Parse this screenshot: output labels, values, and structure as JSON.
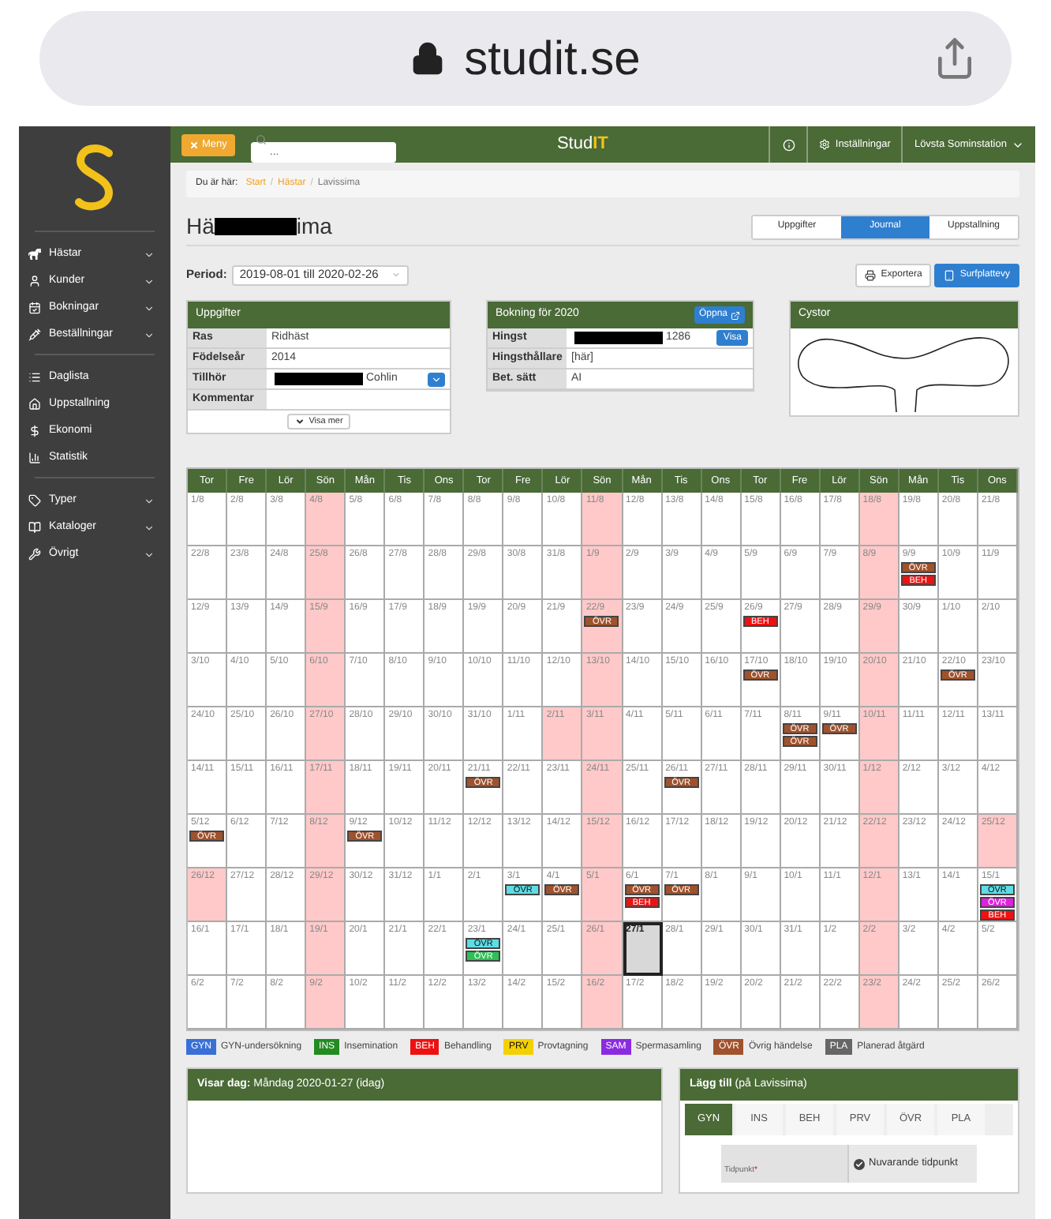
{
  "browser": {
    "url": "studit.se"
  },
  "sidebar": {
    "groups": [
      {
        "items": [
          {
            "label": "Hästar",
            "expandable": true
          },
          {
            "label": "Kunder",
            "expandable": true
          },
          {
            "label": "Bokningar",
            "expandable": true
          },
          {
            "label": "Beställningar",
            "expandable": true
          }
        ]
      },
      {
        "items": [
          {
            "label": "Daglista",
            "expandable": false
          },
          {
            "label": "Uppstallning",
            "expandable": false
          },
          {
            "label": "Ekonomi",
            "expandable": false
          },
          {
            "label": "Statistik",
            "expandable": false
          }
        ]
      },
      {
        "items": [
          {
            "label": "Typer",
            "expandable": true
          },
          {
            "label": "Kataloger",
            "expandable": true
          },
          {
            "label": "Övrigt",
            "expandable": true
          }
        ]
      }
    ]
  },
  "topbar": {
    "menu_button": "Meny",
    "search": {
      "placeholder": "..."
    },
    "brand": {
      "prefix": "Stud",
      "accent": "IT"
    },
    "settings": "Inställningar",
    "user": "Lövsta Sominstation"
  },
  "breadcrumb": {
    "label": "Du är här:",
    "separator": "/",
    "items": [
      {
        "label": "Start",
        "link": true
      },
      {
        "label": "Hästar",
        "link": true
      },
      {
        "label": "Lavissima",
        "link": false
      }
    ]
  },
  "title": {
    "prefix": "Hä",
    "suffix": "ima"
  },
  "tabs": [
    {
      "label": "Uppgifter",
      "selected": false
    },
    {
      "label": "Journal",
      "selected": true
    },
    {
      "label": "Uppstallning",
      "selected": false
    }
  ],
  "period": {
    "label": "Period:",
    "value": "2019-08-01 till 2020-02-26"
  },
  "actions": [
    {
      "label": "Exportera",
      "primary": false
    },
    {
      "label": "Surfplattevy",
      "primary": true
    }
  ],
  "details_panel": {
    "title": "Uppgifter",
    "rows": [
      {
        "label": "Ras",
        "value": "Ridhäst",
        "redacted": false,
        "kind": "plain"
      },
      {
        "label": "Födelseår",
        "value": "2014",
        "redacted": false,
        "kind": "plain"
      },
      {
        "label": "Tillhör",
        "value": "Cohlin",
        "redacted": true,
        "kind": "dropdown"
      },
      {
        "label": "Kommentar",
        "redacted": false,
        "kind": "plain"
      }
    ],
    "more_button": "Visa mer"
  },
  "booking_panel": {
    "title": "Bokning för 2020",
    "open_button": "Öppna",
    "rows": [
      {
        "label": "Hingst",
        "value": "1286",
        "redacted": true,
        "kind": "button",
        "button": "Visa"
      },
      {
        "label": "Hingsthållare",
        "value": "[här]",
        "redacted": false,
        "kind": "plain"
      },
      {
        "label": "Bet. sätt",
        "value": "AI",
        "redacted": false,
        "kind": "plain"
      }
    ]
  },
  "cyst_panel": {
    "title": "Cystor"
  },
  "calendar": {
    "weekdays": [
      "Tor",
      "Fre",
      "Lör",
      "Sön",
      "Mån",
      "Tis",
      "Ons",
      "Tor",
      "Fre",
      "Lör",
      "Sön",
      "Mån",
      "Tis",
      "Ons",
      "Tor",
      "Fre",
      "Lör",
      "Sön",
      "Mån",
      "Tis",
      "Ons"
    ],
    "weeks": [
      {
        "days": [
          {
            "date": "1/8",
            "highlighted": false,
            "today": false
          },
          {
            "date": "2/8",
            "highlighted": false,
            "today": false
          },
          {
            "date": "3/8",
            "highlighted": false,
            "today": false
          },
          {
            "date": "4/8",
            "highlighted": true,
            "today": false
          },
          {
            "date": "5/8",
            "highlighted": false,
            "today": false
          },
          {
            "date": "6/8",
            "highlighted": false,
            "today": false
          },
          {
            "date": "7/8",
            "highlighted": false,
            "today": false
          },
          {
            "date": "8/8",
            "highlighted": false,
            "today": false
          },
          {
            "date": "9/8",
            "highlighted": false,
            "today": false
          },
          {
            "date": "10/8",
            "highlighted": false,
            "today": false
          },
          {
            "date": "11/8",
            "highlighted": true,
            "today": false
          },
          {
            "date": "12/8",
            "highlighted": false,
            "today": false
          },
          {
            "date": "13/8",
            "highlighted": false,
            "today": false
          },
          {
            "date": "14/8",
            "highlighted": false,
            "today": false
          },
          {
            "date": "15/8",
            "highlighted": false,
            "today": false
          },
          {
            "date": "16/8",
            "highlighted": false,
            "today": false
          },
          {
            "date": "17/8",
            "highlighted": false,
            "today": false
          },
          {
            "date": "18/8",
            "highlighted": true,
            "today": false
          },
          {
            "date": "19/8",
            "highlighted": false,
            "today": false
          },
          {
            "date": "20/8",
            "highlighted": false,
            "today": false
          },
          {
            "date": "21/8",
            "highlighted": false,
            "today": false
          }
        ]
      },
      {
        "days": [
          {
            "date": "22/8",
            "highlighted": false,
            "today": false
          },
          {
            "date": "23/8",
            "highlighted": false,
            "today": false
          },
          {
            "date": "24/8",
            "highlighted": false,
            "today": false
          },
          {
            "date": "25/8",
            "highlighted": true,
            "today": false
          },
          {
            "date": "26/8",
            "highlighted": false,
            "today": false
          },
          {
            "date": "27/8",
            "highlighted": false,
            "today": false
          },
          {
            "date": "28/8",
            "highlighted": false,
            "today": false
          },
          {
            "date": "29/8",
            "highlighted": false,
            "today": false
          },
          {
            "date": "30/8",
            "highlighted": false,
            "today": false
          },
          {
            "date": "31/8",
            "highlighted": false,
            "today": false
          },
          {
            "date": "1/9",
            "highlighted": true,
            "today": false
          },
          {
            "date": "2/9",
            "highlighted": false,
            "today": false
          },
          {
            "date": "3/9",
            "highlighted": false,
            "today": false
          },
          {
            "date": "4/9",
            "highlighted": false,
            "today": false
          },
          {
            "date": "5/9",
            "highlighted": false,
            "today": false
          },
          {
            "date": "6/9",
            "highlighted": false,
            "today": false
          },
          {
            "date": "7/9",
            "highlighted": false,
            "today": false
          },
          {
            "date": "8/9",
            "highlighted": true,
            "today": false
          },
          {
            "date": "9/9",
            "highlighted": false,
            "today": false,
            "events": [
              {
                "code": "ÖVR",
                "color": "#a0522d"
              },
              {
                "code": "BEH",
                "color": "#ee1111"
              }
            ]
          },
          {
            "date": "10/9",
            "highlighted": false,
            "today": false
          },
          {
            "date": "11/9",
            "highlighted": false,
            "today": false
          }
        ]
      },
      {
        "days": [
          {
            "date": "12/9",
            "highlighted": false,
            "today": false
          },
          {
            "date": "13/9",
            "highlighted": false,
            "today": false
          },
          {
            "date": "14/9",
            "highlighted": false,
            "today": false
          },
          {
            "date": "15/9",
            "highlighted": true,
            "today": false
          },
          {
            "date": "16/9",
            "highlighted": false,
            "today": false
          },
          {
            "date": "17/9",
            "highlighted": false,
            "today": false
          },
          {
            "date": "18/9",
            "highlighted": false,
            "today": false
          },
          {
            "date": "19/9",
            "highlighted": false,
            "today": false
          },
          {
            "date": "20/9",
            "highlighted": false,
            "today": false
          },
          {
            "date": "21/9",
            "highlighted": false,
            "today": false
          },
          {
            "date": "22/9",
            "highlighted": true,
            "today": false,
            "events": [
              {
                "code": "ÖVR",
                "color": "#a0522d"
              }
            ]
          },
          {
            "date": "23/9",
            "highlighted": false,
            "today": false
          },
          {
            "date": "24/9",
            "highlighted": false,
            "today": false
          },
          {
            "date": "25/9",
            "highlighted": false,
            "today": false
          },
          {
            "date": "26/9",
            "highlighted": false,
            "today": false,
            "events": [
              {
                "code": "BEH",
                "color": "#ee1111"
              }
            ]
          },
          {
            "date": "27/9",
            "highlighted": false,
            "today": false
          },
          {
            "date": "28/9",
            "highlighted": false,
            "today": false
          },
          {
            "date": "29/9",
            "highlighted": true,
            "today": false
          },
          {
            "date": "30/9",
            "highlighted": false,
            "today": false
          },
          {
            "date": "1/10",
            "highlighted": false,
            "today": false
          },
          {
            "date": "2/10",
            "highlighted": false,
            "today": false
          }
        ]
      },
      {
        "days": [
          {
            "date": "3/10",
            "highlighted": false,
            "today": false
          },
          {
            "date": "4/10",
            "highlighted": false,
            "today": false
          },
          {
            "date": "5/10",
            "highlighted": false,
            "today": false
          },
          {
            "date": "6/10",
            "highlighted": true,
            "today": false
          },
          {
            "date": "7/10",
            "highlighted": false,
            "today": false
          },
          {
            "date": "8/10",
            "highlighted": false,
            "today": false
          },
          {
            "date": "9/10",
            "highlighted": false,
            "today": false
          },
          {
            "date": "10/10",
            "highlighted": false,
            "today": false
          },
          {
            "date": "11/10",
            "highlighted": false,
            "today": false
          },
          {
            "date": "12/10",
            "highlighted": false,
            "today": false
          },
          {
            "date": "13/10",
            "highlighted": true,
            "today": false
          },
          {
            "date": "14/10",
            "highlighted": false,
            "today": false
          },
          {
            "date": "15/10",
            "highlighted": false,
            "today": false
          },
          {
            "date": "16/10",
            "highlighted": false,
            "today": false
          },
          {
            "date": "17/10",
            "highlighted": false,
            "today": false,
            "events": [
              {
                "code": "ÖVR",
                "color": "#a0522d"
              }
            ]
          },
          {
            "date": "18/10",
            "highlighted": false,
            "today": false
          },
          {
            "date": "19/10",
            "highlighted": false,
            "today": false
          },
          {
            "date": "20/10",
            "highlighted": true,
            "today": false
          },
          {
            "date": "21/10",
            "highlighted": false,
            "today": false
          },
          {
            "date": "22/10",
            "highlighted": false,
            "today": false,
            "events": [
              {
                "code": "ÖVR",
                "color": "#a0522d"
              }
            ]
          },
          {
            "date": "23/10",
            "highlighted": false,
            "today": false
          }
        ]
      },
      {
        "days": [
          {
            "date": "24/10",
            "highlighted": false,
            "today": false
          },
          {
            "date": "25/10",
            "highlighted": false,
            "today": false
          },
          {
            "date": "26/10",
            "highlighted": false,
            "today": false
          },
          {
            "date": "27/10",
            "highlighted": true,
            "today": false
          },
          {
            "date": "28/10",
            "highlighted": false,
            "today": false
          },
          {
            "date": "29/10",
            "highlighted": false,
            "today": false
          },
          {
            "date": "30/10",
            "highlighted": false,
            "today": false
          },
          {
            "date": "31/10",
            "highlighted": false,
            "today": false
          },
          {
            "date": "1/11",
            "highlighted": false,
            "today": false
          },
          {
            "date": "2/11",
            "highlighted": true,
            "today": false
          },
          {
            "date": "3/11",
            "highlighted": true,
            "today": false
          },
          {
            "date": "4/11",
            "highlighted": false,
            "today": false
          },
          {
            "date": "5/11",
            "highlighted": false,
            "today": false
          },
          {
            "date": "6/11",
            "highlighted": false,
            "today": false
          },
          {
            "date": "7/11",
            "highlighted": false,
            "today": false
          },
          {
            "date": "8/11",
            "highlighted": false,
            "today": false,
            "events": [
              {
                "code": "ÖVR",
                "color": "#a0522d"
              },
              {
                "code": "ÖVR",
                "color": "#a0522d"
              }
            ]
          },
          {
            "date": "9/11",
            "highlighted": false,
            "today": false,
            "events": [
              {
                "code": "ÖVR",
                "color": "#a0522d"
              }
            ]
          },
          {
            "date": "10/11",
            "highlighted": true,
            "today": false
          },
          {
            "date": "11/11",
            "highlighted": false,
            "today": false
          },
          {
            "date": "12/11",
            "highlighted": false,
            "today": false
          },
          {
            "date": "13/11",
            "highlighted": false,
            "today": false
          }
        ]
      },
      {
        "days": [
          {
            "date": "14/11",
            "highlighted": false,
            "today": false
          },
          {
            "date": "15/11",
            "highlighted": false,
            "today": false
          },
          {
            "date": "16/11",
            "highlighted": false,
            "today": false
          },
          {
            "date": "17/11",
            "highlighted": true,
            "today": false
          },
          {
            "date": "18/11",
            "highlighted": false,
            "today": false
          },
          {
            "date": "19/11",
            "highlighted": false,
            "today": false
          },
          {
            "date": "20/11",
            "highlighted": false,
            "today": false
          },
          {
            "date": "21/11",
            "highlighted": false,
            "today": false,
            "events": [
              {
                "code": "ÖVR",
                "color": "#a0522d"
              }
            ]
          },
          {
            "date": "22/11",
            "highlighted": false,
            "today": false
          },
          {
            "date": "23/11",
            "highlighted": false,
            "today": false
          },
          {
            "date": "24/11",
            "highlighted": true,
            "today": false
          },
          {
            "date": "25/11",
            "highlighted": false,
            "today": false
          },
          {
            "date": "26/11",
            "highlighted": false,
            "today": false,
            "events": [
              {
                "code": "ÖVR",
                "color": "#a0522d"
              }
            ]
          },
          {
            "date": "27/11",
            "highlighted": false,
            "today": false
          },
          {
            "date": "28/11",
            "highlighted": false,
            "today": false
          },
          {
            "date": "29/11",
            "highlighted": false,
            "today": false
          },
          {
            "date": "30/11",
            "highlighted": false,
            "today": false
          },
          {
            "date": "1/12",
            "highlighted": true,
            "today": false
          },
          {
            "date": "2/12",
            "highlighted": false,
            "today": false
          },
          {
            "date": "3/12",
            "highlighted": false,
            "today": false
          },
          {
            "date": "4/12",
            "highlighted": false,
            "today": false
          }
        ]
      },
      {
        "days": [
          {
            "date": "5/12",
            "highlighted": false,
            "today": false,
            "events": [
              {
                "code": "ÖVR",
                "color": "#a0522d"
              }
            ]
          },
          {
            "date": "6/12",
            "highlighted": false,
            "today": false
          },
          {
            "date": "7/12",
            "highlighted": false,
            "today": false
          },
          {
            "date": "8/12",
            "highlighted": true,
            "today": false
          },
          {
            "date": "9/12",
            "highlighted": false,
            "today": false,
            "events": [
              {
                "code": "ÖVR",
                "color": "#a0522d"
              }
            ]
          },
          {
            "date": "10/12",
            "highlighted": false,
            "today": false
          },
          {
            "date": "11/12",
            "highlighted": false,
            "today": false
          },
          {
            "date": "12/12",
            "highlighted": false,
            "today": false
          },
          {
            "date": "13/12",
            "highlighted": false,
            "today": false
          },
          {
            "date": "14/12",
            "highlighted": false,
            "today": false
          },
          {
            "date": "15/12",
            "highlighted": true,
            "today": false
          },
          {
            "date": "16/12",
            "highlighted": false,
            "today": false
          },
          {
            "date": "17/12",
            "highlighted": false,
            "today": false
          },
          {
            "date": "18/12",
            "highlighted": false,
            "today": false
          },
          {
            "date": "19/12",
            "highlighted": false,
            "today": false
          },
          {
            "date": "20/12",
            "highlighted": false,
            "today": false
          },
          {
            "date": "21/12",
            "highlighted": false,
            "today": false
          },
          {
            "date": "22/12",
            "highlighted": true,
            "today": false
          },
          {
            "date": "23/12",
            "highlighted": false,
            "today": false
          },
          {
            "date": "24/12",
            "highlighted": false,
            "today": false
          },
          {
            "date": "25/12",
            "highlighted": true,
            "today": false
          }
        ]
      },
      {
        "days": [
          {
            "date": "26/12",
            "highlighted": true,
            "today": false
          },
          {
            "date": "27/12",
            "highlighted": false,
            "today": false
          },
          {
            "date": "28/12",
            "highlighted": false,
            "today": false
          },
          {
            "date": "29/12",
            "highlighted": true,
            "today": false
          },
          {
            "date": "30/12",
            "highlighted": false,
            "today": false
          },
          {
            "date": "31/12",
            "highlighted": false,
            "today": false
          },
          {
            "date": "1/1",
            "highlighted": false,
            "today": false
          },
          {
            "date": "2/1",
            "highlighted": false,
            "today": false
          },
          {
            "date": "3/1",
            "highlighted": false,
            "today": false,
            "events": [
              {
                "code": "ÖVR",
                "color": "#5fdde5"
              }
            ]
          },
          {
            "date": "4/1",
            "highlighted": false,
            "today": false,
            "events": [
              {
                "code": "ÖVR",
                "color": "#a0522d"
              }
            ]
          },
          {
            "date": "5/1",
            "highlighted": true,
            "today": false
          },
          {
            "date": "6/1",
            "highlighted": false,
            "today": false,
            "events": [
              {
                "code": "ÖVR",
                "color": "#a0522d"
              },
              {
                "code": "BEH",
                "color": "#ee1111"
              }
            ]
          },
          {
            "date": "7/1",
            "highlighted": false,
            "today": false,
            "events": [
              {
                "code": "ÖVR",
                "color": "#a0522d"
              }
            ]
          },
          {
            "date": "8/1",
            "highlighted": false,
            "today": false
          },
          {
            "date": "9/1",
            "highlighted": false,
            "today": false
          },
          {
            "date": "10/1",
            "highlighted": false,
            "today": false
          },
          {
            "date": "11/1",
            "highlighted": false,
            "today": false
          },
          {
            "date": "12/1",
            "highlighted": true,
            "today": false
          },
          {
            "date": "13/1",
            "highlighted": false,
            "today": false
          },
          {
            "date": "14/1",
            "highlighted": false,
            "today": false
          },
          {
            "date": "15/1",
            "highlighted": false,
            "today": false,
            "events": [
              {
                "code": "ÖVR",
                "color": "#5fdde5"
              },
              {
                "code": "ÖVR",
                "color": "#e020e0"
              },
              {
                "code": "BEH",
                "color": "#ee1111"
              }
            ]
          }
        ]
      },
      {
        "days": [
          {
            "date": "16/1",
            "highlighted": false,
            "today": false
          },
          {
            "date": "17/1",
            "highlighted": false,
            "today": false
          },
          {
            "date": "18/1",
            "highlighted": false,
            "today": false
          },
          {
            "date": "19/1",
            "highlighted": true,
            "today": false
          },
          {
            "date": "20/1",
            "highlighted": false,
            "today": false
          },
          {
            "date": "21/1",
            "highlighted": false,
            "today": false
          },
          {
            "date": "22/1",
            "highlighted": false,
            "today": false
          },
          {
            "date": "23/1",
            "highlighted": false,
            "today": false,
            "events": [
              {
                "code": "ÖVR",
                "color": "#5fdde5"
              },
              {
                "code": "ÖVR",
                "color": "#2fbf55"
              }
            ]
          },
          {
            "date": "24/1",
            "highlighted": false,
            "today": false
          },
          {
            "date": "25/1",
            "highlighted": false,
            "today": false
          },
          {
            "date": "26/1",
            "highlighted": true,
            "today": false
          },
          {
            "date": "27/1",
            "highlighted": false,
            "today": true
          },
          {
            "date": "28/1",
            "highlighted": false,
            "today": false
          },
          {
            "date": "29/1",
            "highlighted": false,
            "today": false
          },
          {
            "date": "30/1",
            "highlighted": false,
            "today": false
          },
          {
            "date": "31/1",
            "highlighted": false,
            "today": false
          },
          {
            "date": "1/2",
            "highlighted": false,
            "today": false
          },
          {
            "date": "2/2",
            "highlighted": true,
            "today": false
          },
          {
            "date": "3/2",
            "highlighted": false,
            "today": false
          },
          {
            "date": "4/2",
            "highlighted": false,
            "today": false
          },
          {
            "date": "5/2",
            "highlighted": false,
            "today": false
          }
        ]
      },
      {
        "days": [
          {
            "date": "6/2",
            "highlighted": false,
            "today": false
          },
          {
            "date": "7/2",
            "highlighted": false,
            "today": false
          },
          {
            "date": "8/2",
            "highlighted": false,
            "today": false
          },
          {
            "date": "9/2",
            "highlighted": true,
            "today": false
          },
          {
            "date": "10/2",
            "highlighted": false,
            "today": false
          },
          {
            "date": "11/2",
            "highlighted": false,
            "today": false
          },
          {
            "date": "12/2",
            "highlighted": false,
            "today": false
          },
          {
            "date": "13/2",
            "highlighted": false,
            "today": false
          },
          {
            "date": "14/2",
            "highlighted": false,
            "today": false
          },
          {
            "date": "15/2",
            "highlighted": false,
            "today": false
          },
          {
            "date": "16/2",
            "highlighted": true,
            "today": false
          },
          {
            "date": "17/2",
            "highlighted": false,
            "today": false
          },
          {
            "date": "18/2",
            "highlighted": false,
            "today": false
          },
          {
            "date": "19/2",
            "highlighted": false,
            "today": false
          },
          {
            "date": "20/2",
            "highlighted": false,
            "today": false
          },
          {
            "date": "21/2",
            "highlighted": false,
            "today": false
          },
          {
            "date": "22/2",
            "highlighted": false,
            "today": false
          },
          {
            "date": "23/2",
            "highlighted": true,
            "today": false
          },
          {
            "date": "24/2",
            "highlighted": false,
            "today": false
          },
          {
            "date": "25/2",
            "highlighted": false,
            "today": false
          },
          {
            "date": "26/2",
            "highlighted": false,
            "today": false
          }
        ]
      }
    ]
  },
  "legend": [
    {
      "code": "GYN",
      "label": "GYN-undersökning",
      "color": "#3a6fd8"
    },
    {
      "code": "INS",
      "label": "Insemination",
      "color": "#228b22"
    },
    {
      "code": "BEH",
      "label": "Behandling",
      "color": "#ee1111"
    },
    {
      "code": "PRV",
      "label": "Provtagning",
      "color": "#f5d000"
    },
    {
      "code": "SAM",
      "label": "Spermasamling",
      "color": "#8a2be2"
    },
    {
      "code": "ÖVR",
      "label": "Övrig händelse",
      "color": "#a0522d"
    },
    {
      "code": "PLA",
      "label": "Planerad åtgärd",
      "color": "#666666"
    }
  ],
  "day_panel": {
    "title": "**Visar dag:** Måndag 2020-01-27 (idag)"
  },
  "add_panel": {
    "title": "**Lägg till** (på Lavissima)",
    "tabs": [
      {
        "label": "GYN",
        "selected": true
      },
      {
        "label": "INS",
        "selected": false
      },
      {
        "label": "BEH",
        "selected": false
      },
      {
        "label": "PRV",
        "selected": false
      },
      {
        "label": "ÖVR",
        "selected": false
      },
      {
        "label": "PLA",
        "selected": false
      }
    ],
    "time_label": "Tidpunkt",
    "required_mark": "*",
    "current_time": {
      "label": "Nuvarande tidpunkt",
      "checked": true
    }
  }
}
